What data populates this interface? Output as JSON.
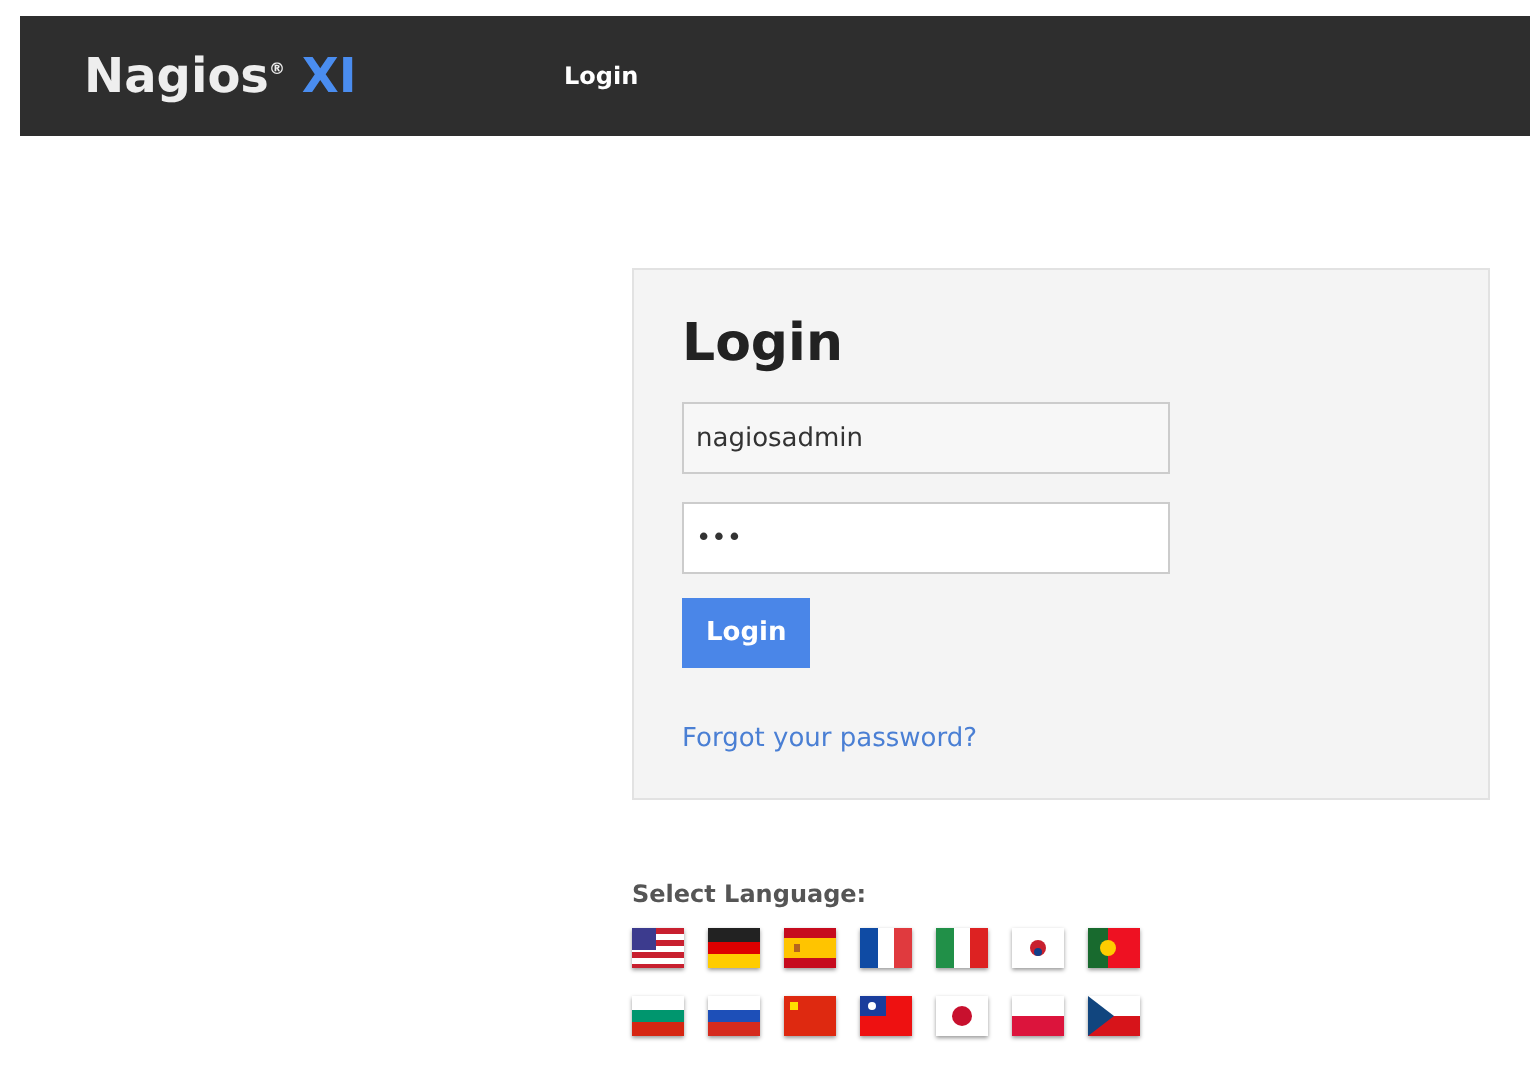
{
  "header": {
    "logo": {
      "name": "Nagios",
      "mark": "®",
      "product": "XI"
    },
    "nav": [
      {
        "label": "Login",
        "selected": true
      }
    ]
  },
  "login": {
    "title": "Login",
    "username": {
      "value": "nagiosadmin"
    },
    "password": {
      "value": "•••"
    },
    "button": "Login",
    "forgot_link": "Forgot your password?"
  },
  "language": {
    "label": "Select Language:"
  }
}
